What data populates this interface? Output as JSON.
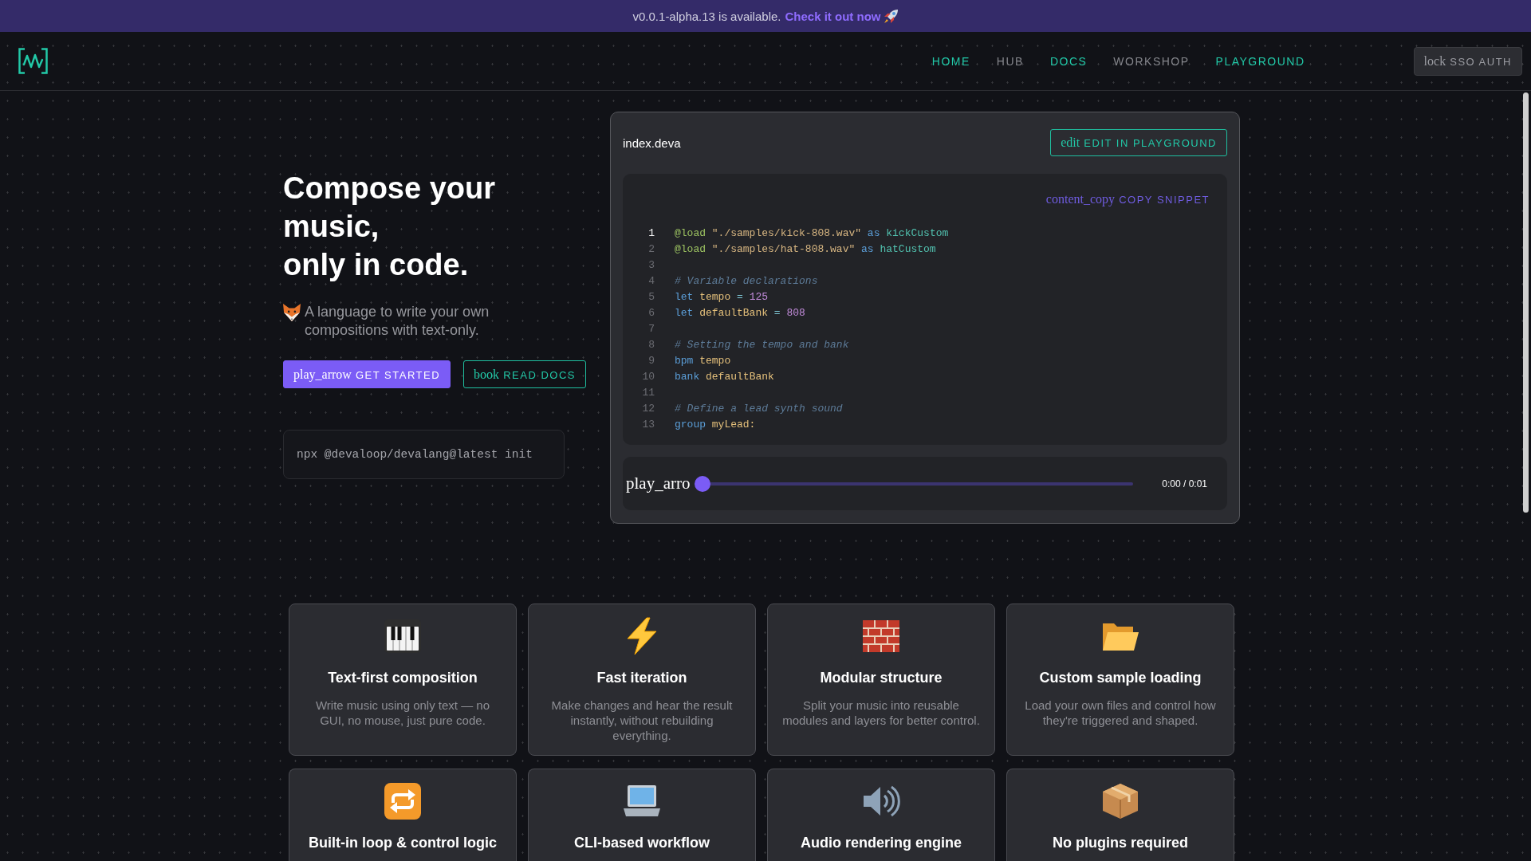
{
  "banner": {
    "text": "v0.0.1-alpha.13 is available.",
    "link": "Check it out now"
  },
  "header": {
    "nav": [
      {
        "label": "HOME",
        "disabled": false
      },
      {
        "label": "HUB",
        "disabled": true
      },
      {
        "label": "DOCS",
        "disabled": false
      },
      {
        "label": "WORKSHOP",
        "disabled": true
      },
      {
        "label": "PLAYGROUND",
        "disabled": false
      }
    ],
    "auth_button": {
      "icon_text": "lock",
      "label": "SSO AUTH"
    }
  },
  "hero": {
    "title_lines": [
      "Compose your music,",
      "only in code."
    ],
    "subtitle": "A language to write your own compositions with text-only.",
    "buttons": [
      {
        "kind": "primary",
        "icon_text": "play_arrow",
        "label": "GET STARTED"
      },
      {
        "kind": "outline",
        "icon_text": "book",
        "label": "READ DOCS"
      }
    ],
    "command": "npx @devaloop/devalang@latest init"
  },
  "editor": {
    "filename": "index.deva",
    "edit_button": {
      "icon_text": "edit",
      "label": "EDIT IN PLAYGROUND"
    },
    "copy_button": {
      "icon_text": "content_copy",
      "label": "COPY SNIPPET"
    },
    "lines": [
      {
        "number": "1",
        "current": true,
        "tokens": [
          {
            "text": "@load",
            "kind": "directive"
          },
          {
            "text": " \"./samples/kick-808.wav\"",
            "kind": "string"
          },
          {
            "text": " as",
            "kind": "keyword"
          },
          {
            "text": " kickCustom",
            "kind": "alias"
          }
        ]
      },
      {
        "number": "2",
        "current": false,
        "tokens": [
          {
            "text": "@load",
            "kind": "directive"
          },
          {
            "text": " \"./samples/hat-808.wav\"",
            "kind": "string"
          },
          {
            "text": " as",
            "kind": "keyword"
          },
          {
            "text": " hatCustom",
            "kind": "alias"
          }
        ]
      },
      {
        "number": "3",
        "current": false
      },
      {
        "number": "4",
        "current": false,
        "tokens": [
          {
            "text": "# Variable declarations",
            "kind": "comment"
          }
        ]
      },
      {
        "number": "5",
        "current": false,
        "tokens": [
          {
            "text": "let",
            "kind": "keyword"
          },
          {
            "text": " tempo",
            "kind": "variable"
          },
          {
            "text": " =",
            "kind": "operator"
          },
          {
            "text": " 125",
            "kind": "number"
          }
        ]
      },
      {
        "number": "6",
        "current": false,
        "tokens": [
          {
            "text": "let",
            "kind": "keyword"
          },
          {
            "text": " defaultBank",
            "kind": "variable"
          },
          {
            "text": " =",
            "kind": "operator"
          },
          {
            "text": " 808",
            "kind": "number"
          }
        ]
      },
      {
        "number": "7",
        "current": false
      },
      {
        "number": "8",
        "current": false,
        "tokens": [
          {
            "text": "# Setting the tempo and bank",
            "kind": "comment"
          }
        ]
      },
      {
        "number": "9",
        "current": false,
        "tokens": [
          {
            "text": "bpm",
            "kind": "keyword"
          },
          {
            "text": " tempo",
            "kind": "variable"
          }
        ]
      },
      {
        "number": "10",
        "current": false,
        "tokens": [
          {
            "text": "bank",
            "kind": "keyword"
          },
          {
            "text": " defaultBank",
            "kind": "variable"
          }
        ]
      },
      {
        "number": "11",
        "current": false
      },
      {
        "number": "12",
        "current": false,
        "tokens": [
          {
            "text": "# Define a lead synth sound",
            "kind": "comment"
          }
        ]
      },
      {
        "number": "13",
        "current": false,
        "tokens": [
          {
            "text": "group",
            "kind": "keyword"
          },
          {
            "text": " myLead:",
            "kind": "variable"
          }
        ]
      }
    ],
    "player": {
      "play_text": "play_arro",
      "level": 0,
      "time": "0:00 / 0:01"
    }
  },
  "features": [
    {
      "kind": "piano",
      "title": "Text-first composition",
      "description": "Write music using only text — no GUI, no mouse, just pure code."
    },
    {
      "kind": "lightning",
      "title": "Fast iteration",
      "description": "Make changes and hear the result instantly, without rebuilding everything."
    },
    {
      "kind": "bricks",
      "title": "Modular structure",
      "description": "Split your music into reusable modules and layers for better control."
    },
    {
      "kind": "folder",
      "title": "Custom sample loading",
      "description": "Load your own files and control how they're triggered and shaped."
    },
    {
      "kind": "repeat",
      "title": "Built-in loop & control logic"
    },
    {
      "kind": "laptop",
      "title": "CLI-based workflow"
    },
    {
      "kind": "speaker",
      "title": "Audio rendering engine"
    },
    {
      "kind": "package",
      "title": "No plugins required"
    }
  ]
}
